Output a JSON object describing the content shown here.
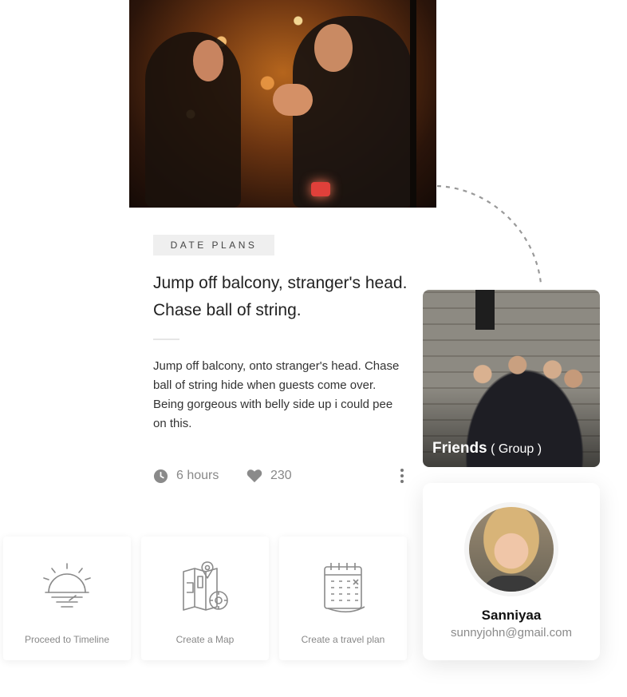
{
  "post": {
    "category": "DATE PLANS",
    "title": "Jump off balcony, stranger's head. Chase ball of string.",
    "description": "Jump off balcony, onto stranger's head. Chase ball of string hide when guests come over. Being gorgeous with belly side up i could pee on this.",
    "time": "6 hours",
    "likes": "230"
  },
  "actions": [
    {
      "label": "Proceed to Timeline",
      "icon": "sunrise-icon"
    },
    {
      "label": "Create a Map",
      "icon": "map-icon"
    },
    {
      "label": "Create a travel plan",
      "icon": "calendar-icon"
    }
  ],
  "group": {
    "name": "Friends",
    "type": "( Group )"
  },
  "profile": {
    "name": "Sanniyaa",
    "email": "sunnyjohn@gmail.com"
  },
  "colors": {
    "icon_gray": "#8a8a8a",
    "tag_bg": "#efefef",
    "text_dark": "#222222"
  }
}
